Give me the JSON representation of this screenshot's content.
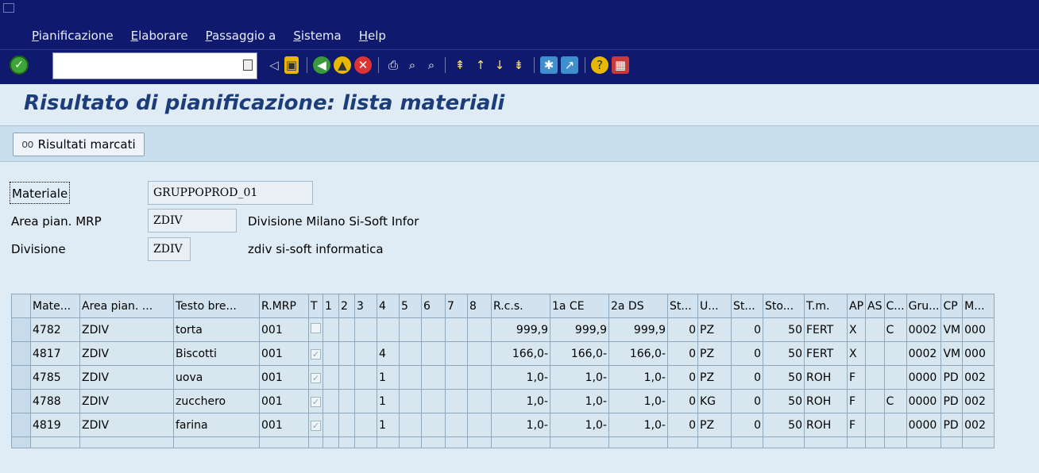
{
  "menu": [
    "Pianificazione",
    "Elaborare",
    "Passaggio a",
    "Sistema",
    "Help"
  ],
  "toolbar": {
    "command_value": ""
  },
  "page_title": "Risultato di pianificazione: lista materiali",
  "app_toolbar": {
    "marked_results_label": "Risultati marcati"
  },
  "header": {
    "material_label": "Materiale",
    "material_value": "GRUPPOPROD_01",
    "mrp_area_label": "Area pian. MRP",
    "mrp_area_value": "ZDIV",
    "mrp_area_desc": "Divisione Milano Si-Soft Infor",
    "plant_label": "Divisione",
    "plant_value": "ZDIV",
    "plant_desc": "zdiv si-soft informatica"
  },
  "table": {
    "columns": [
      "Mate...",
      "Area pian. ...",
      "Testo bre...",
      "R.MRP",
      "T",
      "1",
      "2",
      "3",
      "4",
      "5",
      "6",
      "7",
      "8",
      "R.c.s.",
      "1a CE",
      "2a DS",
      "St...",
      "U...",
      "St...",
      "Sto...",
      "T.m.",
      "AP",
      "AS",
      "C...",
      "Gru...",
      "CP",
      "M..."
    ],
    "rows": [
      [
        "4782",
        "ZDIV",
        "torta",
        "001",
        "",
        "",
        "",
        "",
        "",
        "",
        "",
        "",
        "",
        "999,9",
        "999,9",
        "999,9",
        "0",
        "PZ",
        "0",
        "50",
        "FERT",
        "X",
        "",
        "C",
        "0002",
        "VM",
        "000"
      ],
      [
        "4817",
        "ZDIV",
        "Biscotti",
        "001",
        "✓",
        "",
        "",
        "",
        "4",
        "",
        "",
        "",
        "",
        "166,0-",
        "166,0-",
        "166,0-",
        "0",
        "PZ",
        "0",
        "50",
        "FERT",
        "X",
        "",
        "",
        "0002",
        "VM",
        "000"
      ],
      [
        "4785",
        "ZDIV",
        "uova",
        "001",
        "✓",
        "",
        "",
        "",
        "1",
        "",
        "",
        "",
        "",
        "1,0-",
        "1,0-",
        "1,0-",
        "0",
        "PZ",
        "0",
        "50",
        "ROH",
        "F",
        "",
        "",
        "0000",
        "PD",
        "002"
      ],
      [
        "4788",
        "ZDIV",
        "zucchero",
        "001",
        "✓",
        "",
        "",
        "",
        "1",
        "",
        "",
        "",
        "",
        "1,0-",
        "1,0-",
        "1,0-",
        "0",
        "KG",
        "0",
        "50",
        "ROH",
        "F",
        "",
        "C",
        "0000",
        "PD",
        "002"
      ],
      [
        "4819",
        "ZDIV",
        "farina",
        "001",
        "✓",
        "",
        "",
        "",
        "1",
        "",
        "",
        "",
        "",
        "1,0-",
        "1,0-",
        "1,0-",
        "0",
        "PZ",
        "0",
        "50",
        "ROH",
        "F",
        "",
        "",
        "0000",
        "PD",
        "002"
      ]
    ]
  }
}
